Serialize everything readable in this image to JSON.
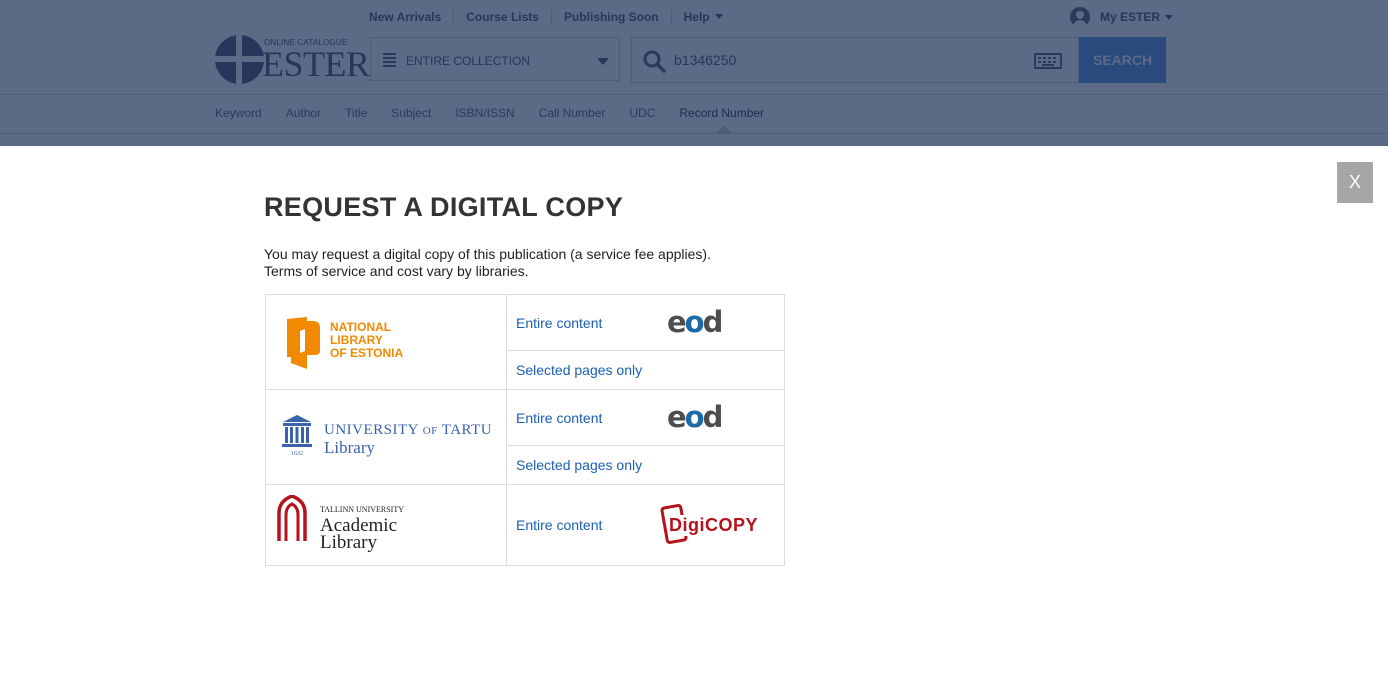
{
  "header": {
    "nav": [
      "New Arrivals",
      "Course Lists",
      "Publishing Soon",
      "Help"
    ],
    "account_label": "My ESTER",
    "logo_small": "ONLINE CATALOGUE",
    "logo_big": "ESTER",
    "collection_value": "ENTIRE COLLECTION",
    "search_value": "b1346250",
    "search_button": "SEARCH",
    "search_types": [
      "Keyword",
      "Author",
      "Title",
      "Subject",
      "ISBN/ISSN",
      "Call Number",
      "UDC",
      "Record Number"
    ],
    "active_search_type": "Record Number"
  },
  "modal": {
    "close_label": "X",
    "title": "REQUEST A DIGITAL COPY",
    "intro_line1": "You may request a digital copy of this publication (a service fee applies).",
    "intro_line2": "Terms of service and cost vary by libraries.",
    "libraries": [
      {
        "logo_lines": [
          "NATIONAL",
          "LIBRARY",
          "OF ESTONIA"
        ],
        "options": [
          {
            "label": "Entire content",
            "service": "eod"
          },
          {
            "label": "Selected pages only",
            "service": ""
          }
        ]
      },
      {
        "logo_line1_a": "UNIVERSITY",
        "logo_line1_b": "OF",
        "logo_line1_c": "TARTU",
        "logo_line2": "Library",
        "logo_year": "1632",
        "options": [
          {
            "label": "Entire content",
            "service": "eod"
          },
          {
            "label": "Selected pages only",
            "service": ""
          }
        ]
      },
      {
        "logo_small": "TALLINN UNIVERSITY",
        "logo_lines": [
          "Academic",
          "Library"
        ],
        "options": [
          {
            "label": "Entire content",
            "service": "DigiCOPY"
          }
        ]
      }
    ]
  },
  "colors": {
    "link": "#1a5fb4",
    "nle_orange": "#f18a00",
    "tartu_blue": "#3a63ab",
    "tallinn_red": "#b5121b",
    "header_dimmed": "#5d6a86"
  }
}
